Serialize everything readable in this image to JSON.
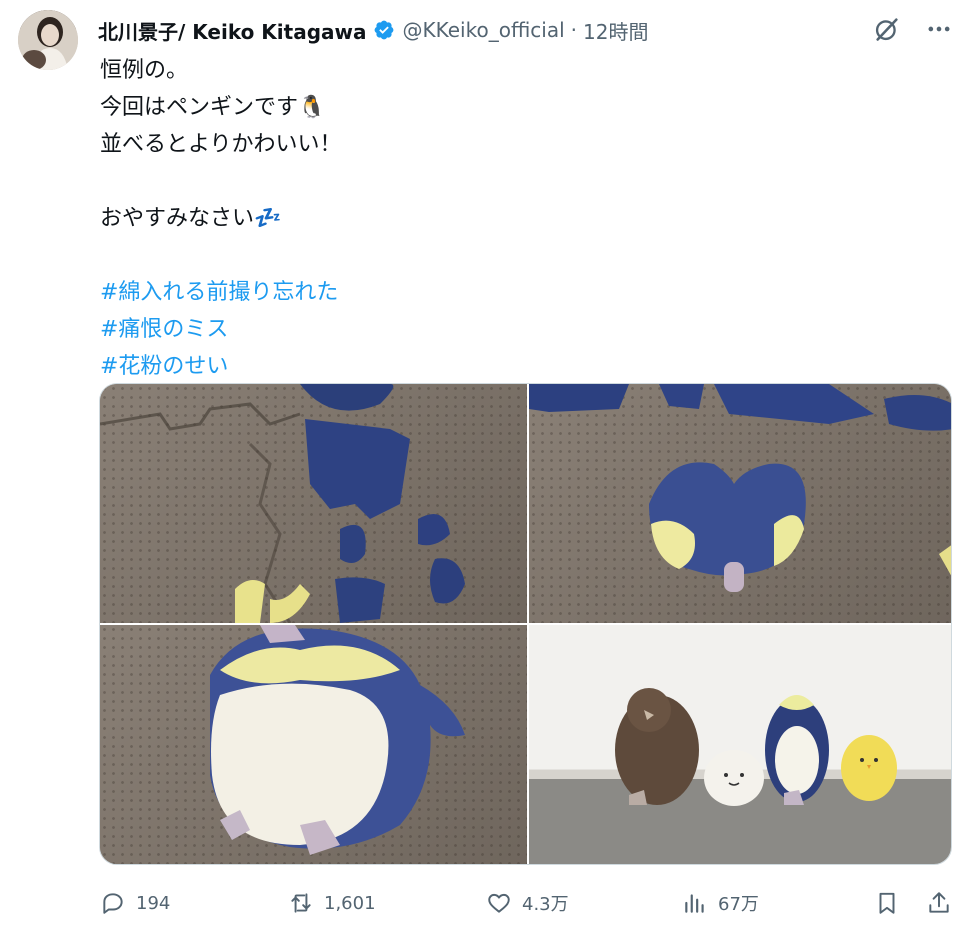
{
  "author": {
    "display_name": "北川景子/ Keiko Kitagawa",
    "handle": "@KKeiko_official",
    "separator": "·",
    "time": "12時間"
  },
  "post": {
    "lines": [
      "恒例の。",
      "今回はペンギンです🐧",
      "並べるとよりかわいい！",
      "",
      "おやすみなさい💤"
    ],
    "hashtags": [
      "#綿入れる前撮り忘れた",
      "#痛恨のミス",
      "#花粉のせい"
    ]
  },
  "media": [
    {
      "name": "photo-fabric-pieces"
    },
    {
      "name": "photo-penguin-head"
    },
    {
      "name": "photo-penguin-closeup"
    },
    {
      "name": "photo-plush-lineup"
    }
  ],
  "metrics": {
    "replies": "194",
    "reposts": "1,601",
    "likes": "4.3万",
    "views": "67万"
  },
  "colors": {
    "link": "#1d9bf0",
    "muted": "#536471",
    "verified": "#1d9bf0",
    "text": "#0f1419"
  }
}
